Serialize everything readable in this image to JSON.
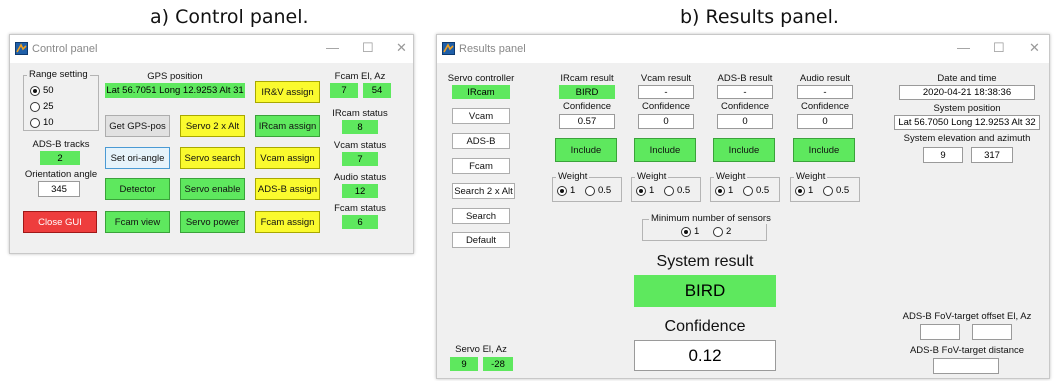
{
  "captions": {
    "control": "a) Control panel.",
    "results": "b) Results panel."
  },
  "control_panel": {
    "title": "Control panel",
    "window_controls": [
      "—",
      "☐",
      "✕"
    ],
    "range": {
      "label": "Range setting",
      "options": [
        "50",
        "25",
        "10"
      ],
      "selected": "50"
    },
    "gps": {
      "label": "GPS position",
      "value": "Lat 56.7051 Long 12.9253 Alt 31"
    },
    "adsb_tracks": {
      "label": "ADS-B tracks",
      "value": "2"
    },
    "orientation": {
      "label": "Orientation angle",
      "value": "345"
    },
    "buttons": {
      "irv_assign": "IR&V assign",
      "get_gps": "Get GPS-pos",
      "servo_2x_alt": "Servo 2 x Alt",
      "ircam_assign": "IRcam assign",
      "set_ori": "Set ori-angle",
      "servo_search": "Servo search",
      "vcam_assign": "Vcam assign",
      "detector": "Detector",
      "servo_enable": "Servo enable",
      "adsb_assign": "ADS-B assign",
      "close_gui": "Close GUI",
      "fcam_view": "Fcam view",
      "servo_power": "Servo power",
      "fcam_assign": "Fcam assign"
    },
    "fcam_el_az": {
      "label": "Fcam El, Az",
      "el": "7",
      "az": "54"
    },
    "ircam_status": {
      "label": "IRcam status",
      "value": "8"
    },
    "vcam_status": {
      "label": "Vcam status",
      "value": "7"
    },
    "audio_status": {
      "label": "Audio status",
      "value": "12"
    },
    "fcam_status": {
      "label": "Fcam status",
      "value": "6"
    }
  },
  "results_panel": {
    "title": "Results panel",
    "window_controls": [
      "—",
      "☐",
      "✕"
    ],
    "servo_controller": {
      "label": "Servo controller",
      "value": "IRcam"
    },
    "side_buttons": [
      "Vcam",
      "ADS-B",
      "Fcam",
      "Search 2 x Alt",
      "Search",
      "Default"
    ],
    "sensors": [
      {
        "result_label": "IRcam result",
        "result": "BIRD",
        "confidence_label": "Confidence",
        "confidence": "0.57",
        "include": "Include",
        "weight_label": "Weight",
        "weight_options": [
          "1",
          "0.5"
        ],
        "weight_selected": "1"
      },
      {
        "result_label": "Vcam result",
        "result": "-",
        "confidence_label": "Confidence",
        "confidence": "0",
        "include": "Include",
        "weight_label": "Weight",
        "weight_options": [
          "1",
          "0.5"
        ],
        "weight_selected": "1"
      },
      {
        "result_label": "ADS-B result",
        "result": "-",
        "confidence_label": "Confidence",
        "confidence": "0",
        "include": "Include",
        "weight_label": "Weight",
        "weight_options": [
          "1",
          "0.5"
        ],
        "weight_selected": "1"
      },
      {
        "result_label": "Audio result",
        "result": "-",
        "confidence_label": "Confidence",
        "confidence": "0",
        "include": "Include",
        "weight_label": "Weight",
        "weight_options": [
          "1",
          "0.5"
        ],
        "weight_selected": "1"
      }
    ],
    "min_sensors": {
      "label": "Minimum number of sensors",
      "options": [
        "1",
        "2"
      ],
      "selected": "1"
    },
    "system_result": {
      "label": "System result",
      "value": "BIRD"
    },
    "confidence": {
      "label": "Confidence",
      "value": "0.12"
    },
    "date_time": {
      "label": "Date and time",
      "value": "2020-04-21   18:38:36"
    },
    "system_position": {
      "label": "System position",
      "value": "Lat 56.7050 Long 12.9253 Alt 32"
    },
    "system_el_az": {
      "label": "System elevation and azimuth",
      "el": "9",
      "az": "317"
    },
    "servo_el_az": {
      "label": "Servo El, Az",
      "el": "9",
      "az": "-28"
    },
    "adsb_offset": {
      "label": "ADS-B FoV-target offset El, Az",
      "el": "",
      "az": ""
    },
    "adsb_distance": {
      "label": "ADS-B FoV-target distance",
      "value": ""
    }
  },
  "colors": {
    "green": "#5ee85e",
    "yellow": "#fafa2e",
    "red": "#ee3d3d",
    "light_blue": "#e6f3fb",
    "window_bg": "#f0f0f0"
  },
  "icons": {
    "app": "matlab-figure-icon"
  }
}
